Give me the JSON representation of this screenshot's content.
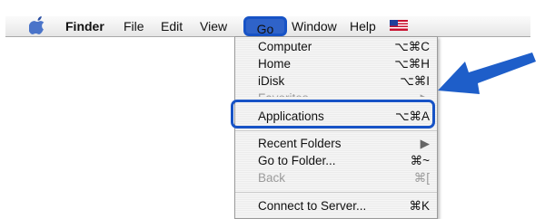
{
  "menubar": {
    "apple_icon": "apple-logo-icon",
    "items": [
      {
        "label": "Finder"
      },
      {
        "label": "File"
      },
      {
        "label": "Edit"
      },
      {
        "label": "View"
      },
      {
        "label": "Go"
      },
      {
        "label": "Window"
      },
      {
        "label": "Help"
      }
    ],
    "flag_icon": "us-flag-icon"
  },
  "go_menu": {
    "items": [
      {
        "label": "Computer",
        "shortcut": "⌥⌘C"
      },
      {
        "label": "Home",
        "shortcut": "⌥⌘H"
      },
      {
        "label": "iDisk",
        "shortcut": "⌥⌘I"
      },
      {
        "label": "Favorites",
        "shortcut": "▶"
      },
      {
        "label": "Applications",
        "shortcut": "⌥⌘A"
      },
      {
        "label": "Recent Folders",
        "shortcut": "▶"
      },
      {
        "label": "Go to Folder...",
        "shortcut": "⌘~"
      },
      {
        "label": "Back",
        "shortcut": "⌘["
      },
      {
        "label": "Connect to Server...",
        "shortcut": "⌘K"
      }
    ]
  },
  "colors": {
    "highlight_blue": "#1753c6",
    "arrow_blue": "#1e5ec9"
  }
}
